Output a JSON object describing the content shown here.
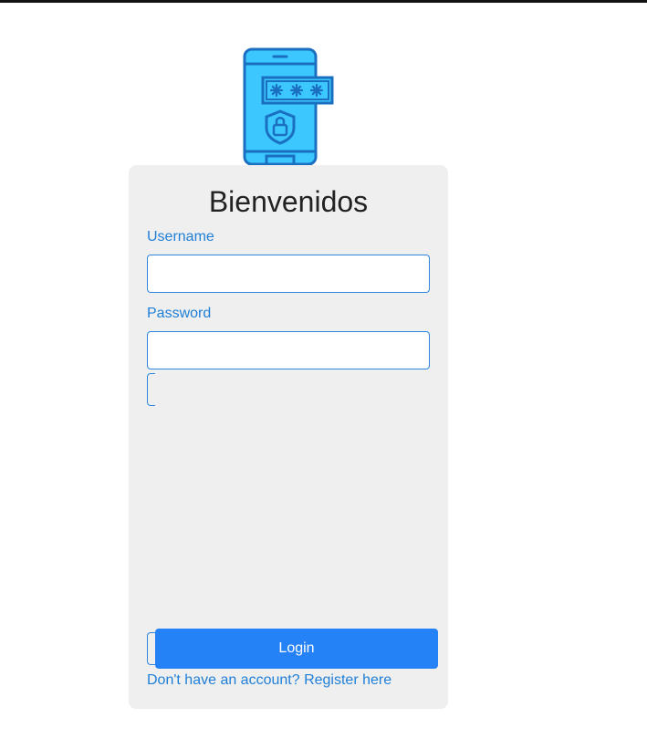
{
  "colors": {
    "accent": "#1f7fd8",
    "button": "#2481f6",
    "card_background": "#efefef",
    "logo_fill": "#3cc8ff",
    "logo_stroke": "#1a6fc0"
  },
  "logo": {
    "icon": "phone-password-shield-icon",
    "password_mask": "***"
  },
  "login_form": {
    "title": "Bienvenidos",
    "username_label": "Username",
    "username_value": "",
    "password_label": "Password",
    "password_value": "",
    "submit_label": "Login",
    "register_link": "Don't have an account? Register here"
  }
}
